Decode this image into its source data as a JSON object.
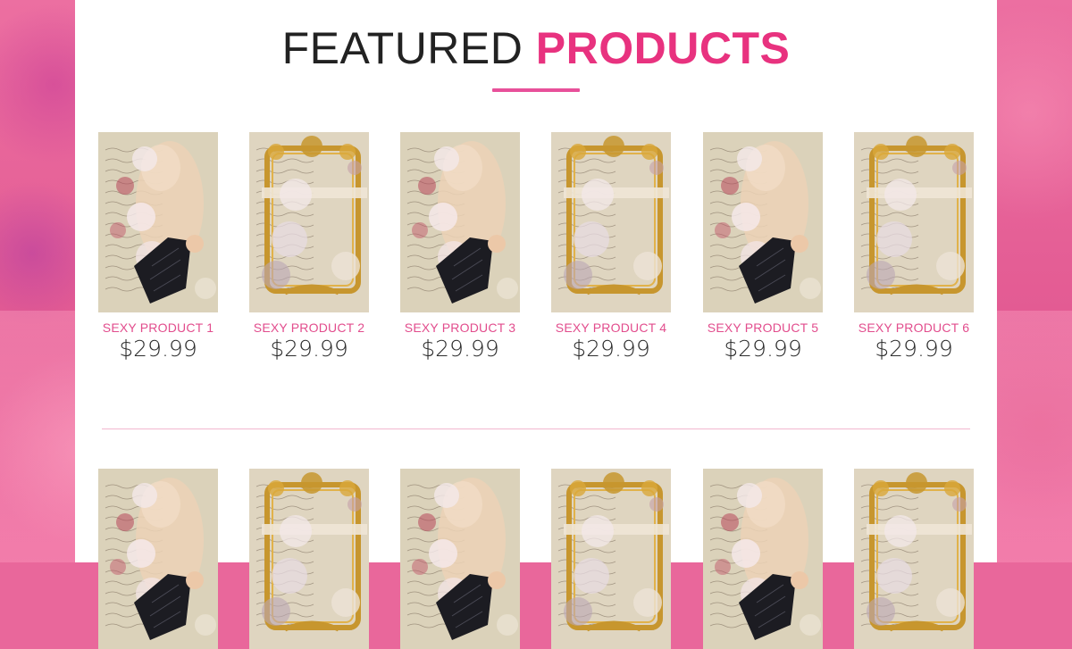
{
  "section": {
    "title_prefix": "FEATURED",
    "title_accent": "PRODUCTS"
  },
  "products": [
    {
      "name": "SEXY PRODUCT 1",
      "price": "$29.99",
      "art": "corset"
    },
    {
      "name": "SEXY PRODUCT 2",
      "price": "$29.99",
      "art": "frame"
    },
    {
      "name": "SEXY PRODUCT 3",
      "price": "$29.99",
      "art": "corset"
    },
    {
      "name": "SEXY PRODUCT 4",
      "price": "$29.99",
      "art": "frame"
    },
    {
      "name": "SEXY PRODUCT 5",
      "price": "$29.99",
      "art": "corset"
    },
    {
      "name": "SEXY PRODUCT 6",
      "price": "$29.99",
      "art": "frame"
    }
  ],
  "second_row_art": [
    "corset",
    "frame",
    "corset",
    "frame",
    "corset",
    "frame"
  ],
  "colors": {
    "accent": "#e8327f",
    "name": "#e24d8d",
    "background": "#e9679b"
  }
}
